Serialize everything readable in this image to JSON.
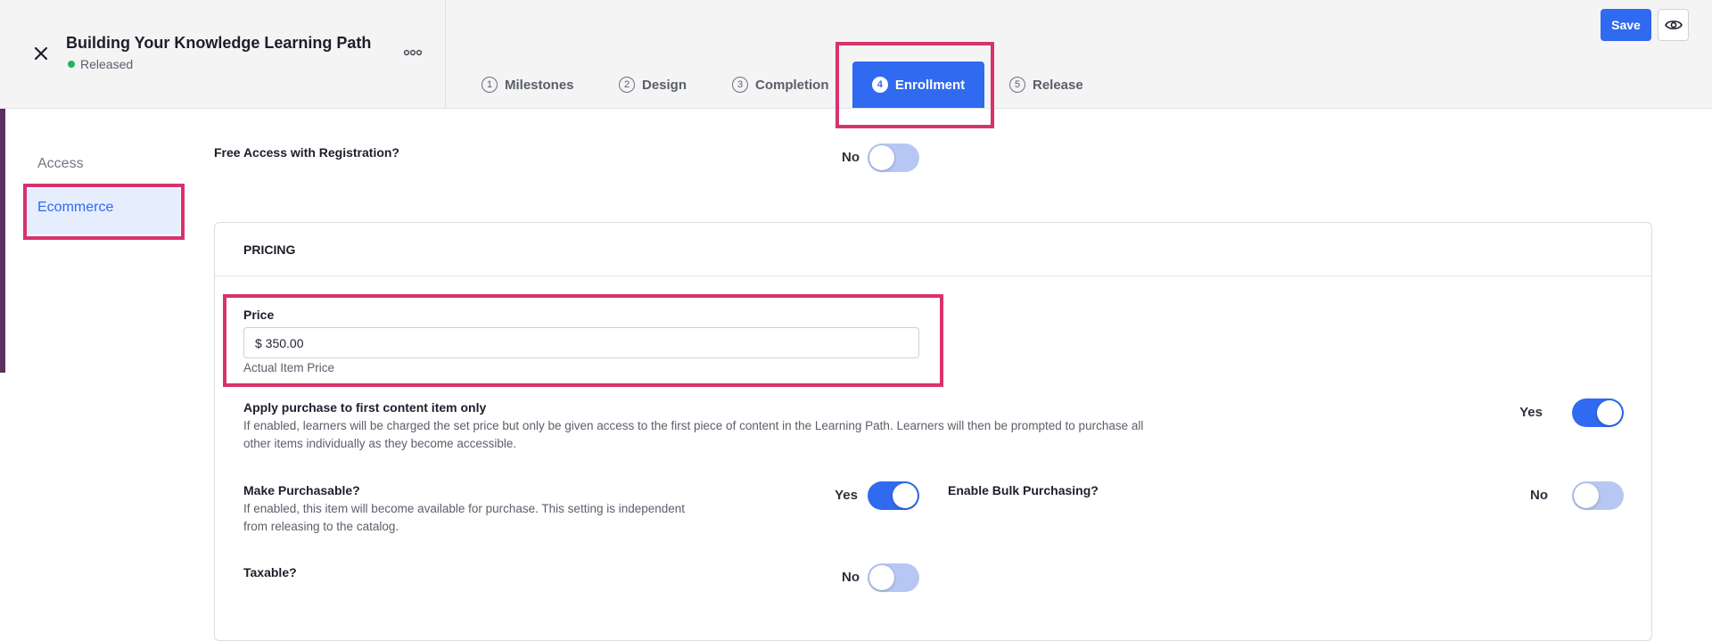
{
  "header": {
    "title": "Building Your Knowledge Learning Path",
    "status": "Released",
    "status_color": "#22b35e",
    "close_icon": "close-icon",
    "more_icon": "more-horizontal-icon",
    "save_label": "Save",
    "preview_icon": "eye-icon"
  },
  "tabs": [
    {
      "number": "1",
      "label": "Milestones",
      "active": false
    },
    {
      "number": "2",
      "label": "Design",
      "active": false
    },
    {
      "number": "3",
      "label": "Completion",
      "active": false
    },
    {
      "number": "4",
      "label": "Enrollment",
      "active": true
    },
    {
      "number": "5",
      "label": "Release",
      "active": false
    }
  ],
  "sidebar": {
    "items": [
      {
        "label": "Access",
        "active": false
      },
      {
        "label": "Ecommerce",
        "active": true
      }
    ]
  },
  "free_access": {
    "label": "Free Access with Registration?",
    "toggle_label": "No",
    "enabled": false
  },
  "pricing": {
    "heading": "PRICING",
    "price": {
      "label": "Price",
      "value": "$ 350.00",
      "help": "Actual Item Price"
    },
    "apply_first": {
      "label": "Apply purchase to first content item only",
      "desc_line1": "If enabled, learners will be charged the set price but only be given access to the first piece of content in the Learning Path. Learners will then be prompted to purchase all",
      "desc_line2": "other items individually as they become accessible.",
      "toggle_label": "Yes",
      "enabled": true
    },
    "purchasable": {
      "label": "Make Purchasable?",
      "desc_line1": "If enabled, this item will become available for purchase. This setting is independent",
      "desc_line2": "from releasing to the catalog.",
      "toggle_label": "Yes",
      "enabled": true
    },
    "bulk": {
      "label": "Enable Bulk Purchasing?",
      "toggle_label": "No",
      "enabled": false
    },
    "taxable": {
      "label": "Taxable?",
      "toggle_label": "No",
      "enabled": false
    }
  },
  "colors": {
    "accent": "#2f6af0",
    "highlight": "#d6336e",
    "toggle_off": "#b6c7f3"
  }
}
